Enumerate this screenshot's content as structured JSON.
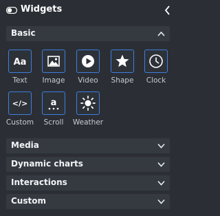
{
  "panel": {
    "title": "Widgets",
    "title_icon": "toggle-icon",
    "collapse_icon": "chevron-left-icon"
  },
  "sections": {
    "basic": {
      "label": "Basic",
      "state": "expanded"
    },
    "media": {
      "label": "Media",
      "state": "collapsed"
    },
    "dynamic_charts": {
      "label": "Dynamic charts",
      "state": "collapsed"
    },
    "interactions": {
      "label": "Interactions",
      "state": "collapsed"
    },
    "custom": {
      "label": "Custom",
      "state": "collapsed"
    }
  },
  "widgets": [
    {
      "label": "Text",
      "icon": "text-icon",
      "glyph": "Aa"
    },
    {
      "label": "Image",
      "icon": "image-icon"
    },
    {
      "label": "Video",
      "icon": "video-play-icon"
    },
    {
      "label": "Shape",
      "icon": "star-icon"
    },
    {
      "label": "Clock",
      "icon": "clock-icon"
    },
    {
      "label": "Custom",
      "icon": "code-icon",
      "glyph": "</>"
    },
    {
      "label": "Scroll",
      "icon": "scroll-text-icon",
      "glyph": "a"
    },
    {
      "label": "Weather",
      "icon": "sun-icon"
    }
  ],
  "colors": {
    "background": "#2b2f35",
    "section_bar": "#353a41",
    "accent_border": "#3d7fe0"
  }
}
